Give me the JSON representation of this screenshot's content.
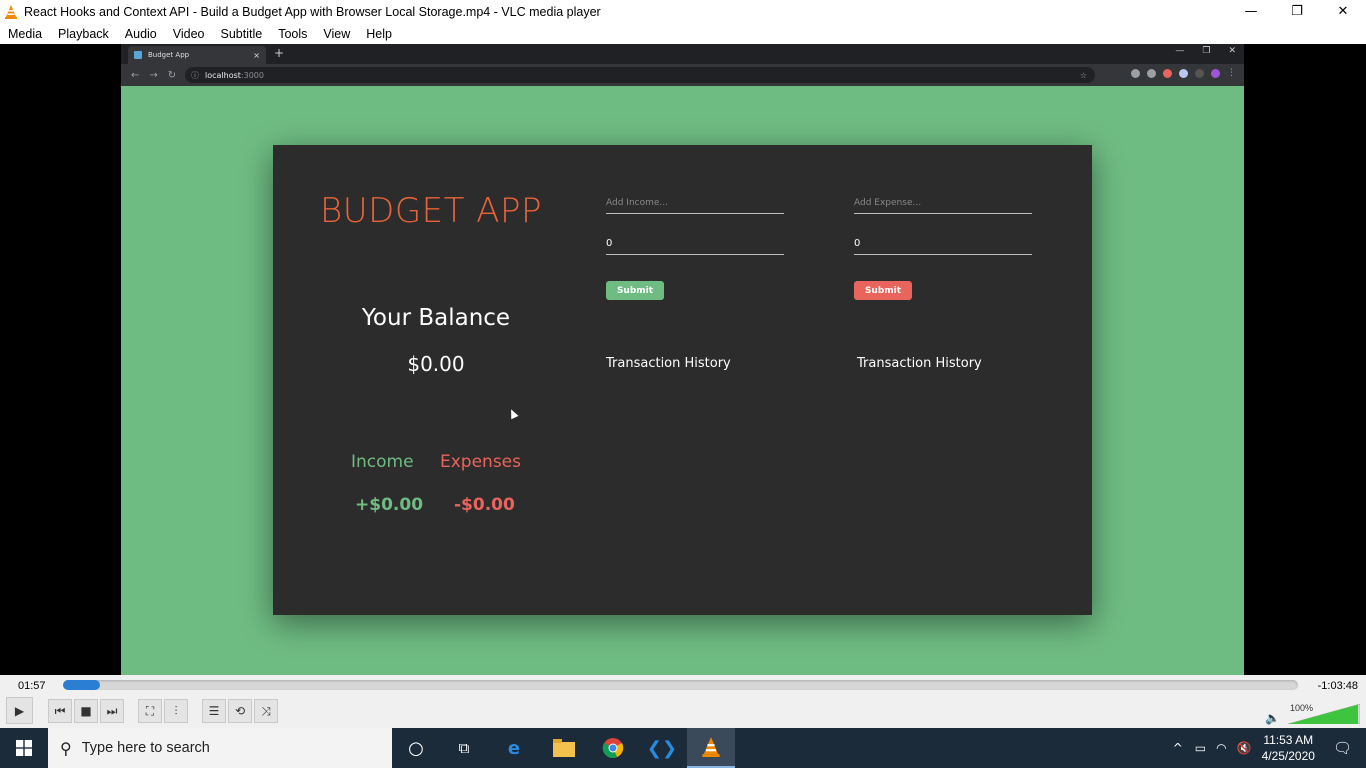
{
  "window": {
    "title": "React Hooks and Context API - Build a Budget App with Browser Local Storage.mp4 - VLC media player",
    "minimize": "—",
    "restore": "❐",
    "close": "✕"
  },
  "menu": [
    "Media",
    "Playback",
    "Audio",
    "Video",
    "Subtitle",
    "Tools",
    "View",
    "Help"
  ],
  "browser": {
    "tab_title": "Budget App",
    "tab_close": "×",
    "new_tab": "+",
    "url_host": "localhost",
    "url_port": ":3000"
  },
  "app": {
    "title": "BUDGET APP",
    "balance_label": "Your Balance",
    "balance_value": "$0.00",
    "income_label": "Income",
    "expenses_label": "Expenses",
    "income_value": "+$0.00",
    "expenses_value": "-$0.00",
    "income_form": {
      "placeholder": "Add Income...",
      "amount": "0",
      "submit": "Submit"
    },
    "expense_form": {
      "placeholder": "Add Expense...",
      "amount": "0",
      "submit": "Submit"
    },
    "income_history": "Transaction History",
    "expense_history": "Transaction History"
  },
  "player": {
    "elapsed": "01:57",
    "remaining": "-1:03:48",
    "progress_fraction": 0.03,
    "volume": "100%"
  },
  "taskbar": {
    "search_placeholder": "Type here to search",
    "time": "11:53 AM",
    "date": "4/25/2020"
  },
  "colors": {
    "page_bg": "#6fbc83",
    "card_bg": "#2c2c2c",
    "title_orange": "#e8633a",
    "income_green": "#6fbc83",
    "expense_red": "#e8645c",
    "seek_blue": "#2a7fd4"
  }
}
